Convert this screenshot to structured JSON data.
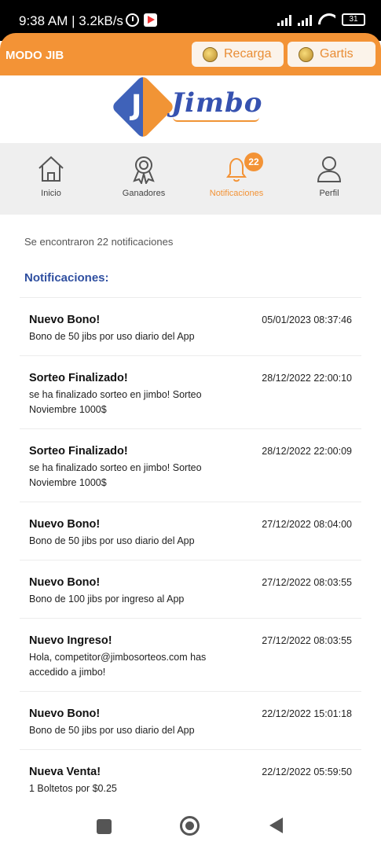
{
  "status_bar": {
    "time": "9:38 AM | 3.2kB/s",
    "battery": "31"
  },
  "app_bar": {
    "mode": "MODO JIB",
    "recarga_label": "Recarga",
    "gartis_label": "Gartis"
  },
  "logo": {
    "letter": "J",
    "text": "Jimbo"
  },
  "nav": {
    "items": [
      {
        "label": "Inicio",
        "icon": "home-icon"
      },
      {
        "label": "Ganadores",
        "icon": "award-icon"
      },
      {
        "label": "Notificaciones",
        "icon": "bell-icon",
        "badge": "22",
        "active": true
      },
      {
        "label": "Perfil",
        "icon": "user-icon"
      }
    ]
  },
  "content": {
    "count_text": "Se encontraron 22 notificaciones",
    "section_title": "Notificaciones:"
  },
  "notifications": [
    {
      "title": "Nuevo Bono!",
      "body": "Bono de 50 jibs por uso diario del App",
      "date": "05/01/2023 08:37:46"
    },
    {
      "title": "Sorteo Finalizado!",
      "body": "se ha finalizado sorteo en jimbo! Sorteo Noviembre 1000$",
      "date": "28/12/2022 22:00:10"
    },
    {
      "title": "Sorteo Finalizado!",
      "body": "se ha finalizado sorteo en jimbo! Sorteo Noviembre 1000$",
      "date": "28/12/2022 22:00:09"
    },
    {
      "title": "Nuevo Bono!",
      "body": "Bono de 50 jibs por uso diario del App",
      "date": "27/12/2022 08:04:00"
    },
    {
      "title": "Nuevo Bono!",
      "body": "Bono de 100 jibs por ingreso al App",
      "date": "27/12/2022 08:03:55"
    },
    {
      "title": "Nuevo Ingreso!",
      "body": "Hola, competitor@jimbosorteos.com has accedido a jimbo!",
      "date": "27/12/2022 08:03:55"
    },
    {
      "title": "Nuevo Bono!",
      "body": "Bono de 50 jibs por uso diario del App",
      "date": "22/12/2022 15:01:18"
    },
    {
      "title": "Nueva Venta!",
      "body": "1 Boltetos por $0.25",
      "date": "22/12/2022 05:59:50"
    }
  ],
  "colors": {
    "accent": "#f39336",
    "brand_blue": "#2f4fa0"
  }
}
